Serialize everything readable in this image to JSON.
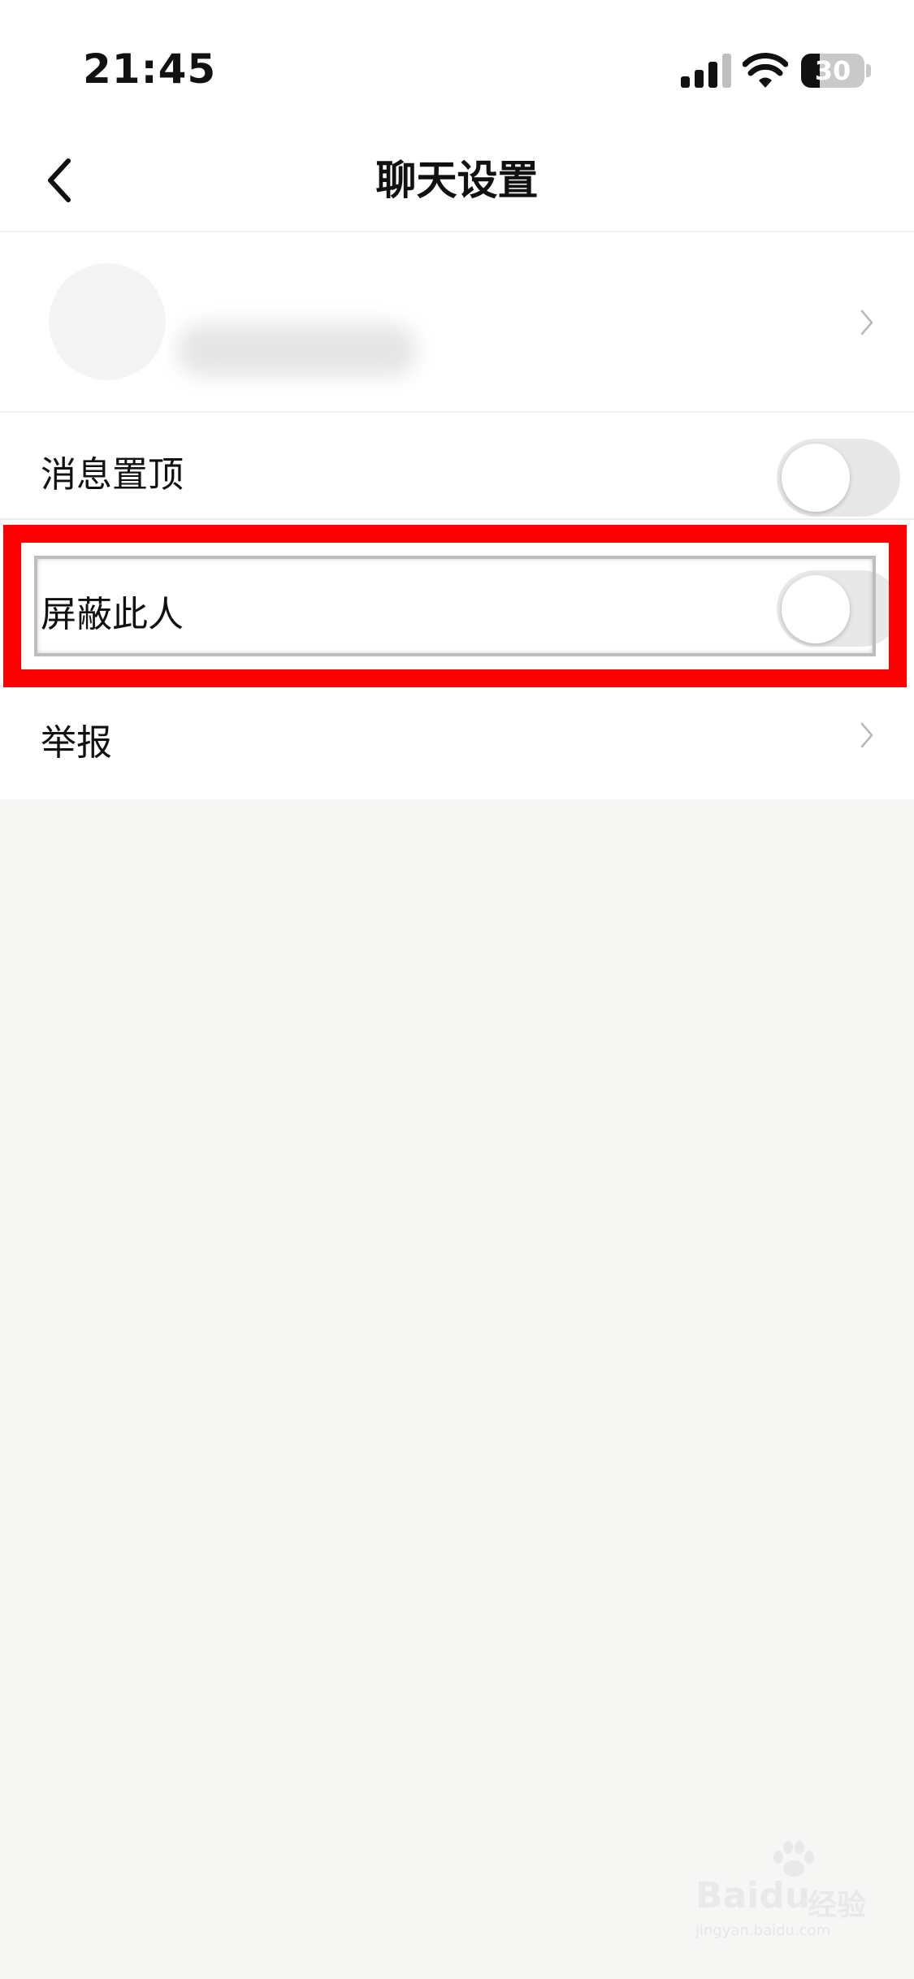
{
  "status_bar": {
    "time": "21:45",
    "battery": "30",
    "battery_level": 0.3,
    "icons": [
      "signal-icon",
      "wifi-icon",
      "battery-icon"
    ]
  },
  "nav": {
    "title": "聊天设置",
    "back_icon": "chevron-left-icon"
  },
  "settings": [
    {
      "label": "消息置顶",
      "control": "toggle",
      "on": false
    },
    {
      "label": "屏蔽此人",
      "control": "toggle",
      "on": false,
      "highlighted": true
    },
    {
      "label": "举报",
      "control": "chevron"
    }
  ],
  "colors": {
    "highlight": "#ff0000",
    "background": "#f6f6f4",
    "toggle_off": "#e8e8e8"
  },
  "watermark": {
    "brand": "Bai",
    "brand2": "du",
    "cn": "经验",
    "sub": "jingyan.baidu.com"
  }
}
